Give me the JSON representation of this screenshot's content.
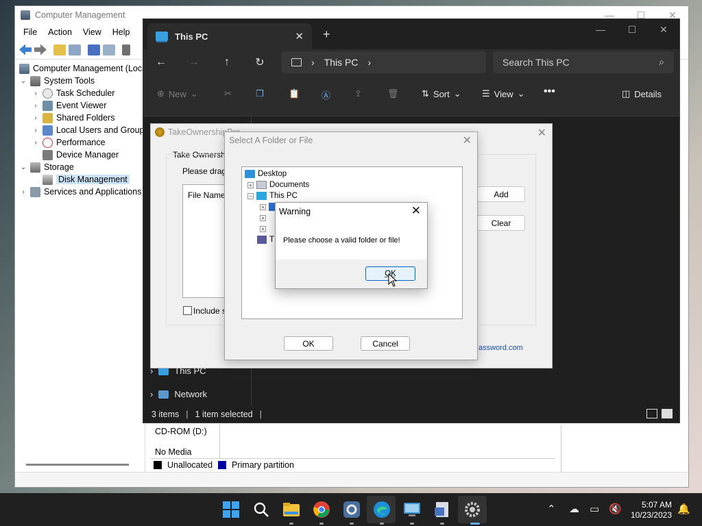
{
  "computer_management": {
    "title": "Computer Management",
    "menu": [
      "File",
      "Action",
      "View",
      "Help"
    ],
    "tree": [
      {
        "label": "Computer Management (Loca",
        "level": 0
      },
      {
        "label": "System Tools",
        "level": 1
      },
      {
        "label": "Task Scheduler",
        "level": 2
      },
      {
        "label": "Event Viewer",
        "level": 2
      },
      {
        "label": "Shared Folders",
        "level": 2
      },
      {
        "label": "Local Users and Groups",
        "level": 2
      },
      {
        "label": "Performance",
        "level": 2
      },
      {
        "label": "Device Manager",
        "level": 2
      },
      {
        "label": "Storage",
        "level": 1
      },
      {
        "label": "Disk Management",
        "level": 2,
        "selected": true
      },
      {
        "label": "Services and Applications",
        "level": 1
      }
    ],
    "disk_cdrom": "CD-ROM (D:)",
    "disk_media": "No Media",
    "legend": {
      "unallocated": "Unallocated",
      "primary": "Primary partition"
    }
  },
  "explorer": {
    "tab_title": "This PC",
    "address": "This PC",
    "search_placeholder": "Search This PC",
    "commands": {
      "new": "New",
      "sort": "Sort",
      "view": "View",
      "details": "Details"
    },
    "nav": {
      "this_pc": "This PC",
      "network": "Network"
    },
    "status": {
      "items": "3 items",
      "selected": "1 item selected"
    }
  },
  "take_ownership": {
    "title": "TakeOwnershipPro",
    "group_label": "Take Ownership",
    "drag_hint": "Please drag a",
    "file_name_header": "File Name",
    "add_button": "Add",
    "clear_button": "Clear",
    "include_label": "Include su",
    "link_text": "assword.com"
  },
  "select_folder": {
    "title": "Select A Folder or File",
    "tree": {
      "desktop": "Desktop",
      "documents": "Documents",
      "this_pc": "This PC",
      "truncated": "T"
    },
    "ok_button": "OK",
    "cancel_button": "Cancel"
  },
  "warning": {
    "title": "Warning",
    "message": "Please choose a valid folder or file!",
    "ok_button": "OK"
  },
  "taskbar": {
    "time": "5:07 AM",
    "date": "10/23/2023"
  }
}
